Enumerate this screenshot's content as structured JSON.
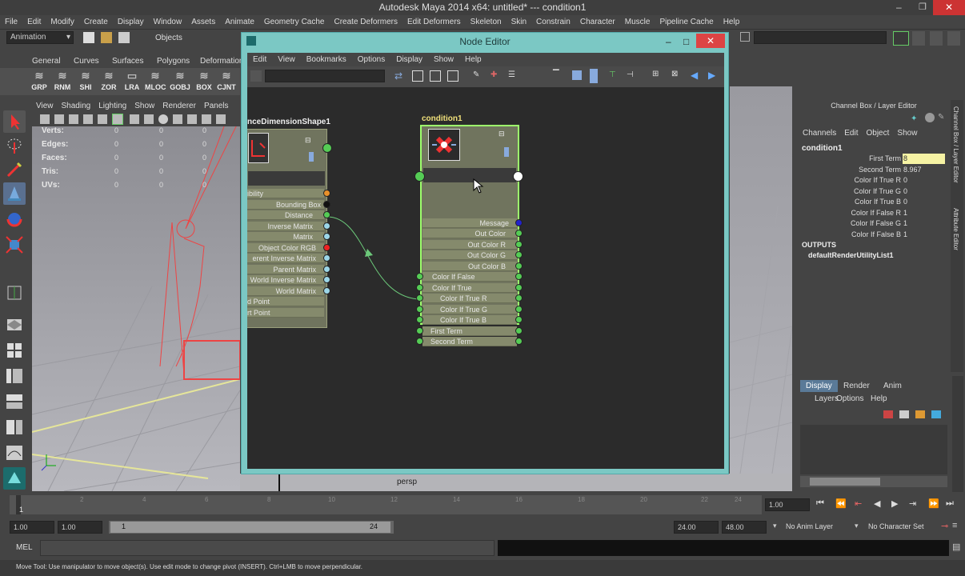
{
  "window": {
    "title": "Autodesk Maya 2014 x64: untitled*   ---   condition1"
  },
  "menubar": [
    "File",
    "Edit",
    "Modify",
    "Create",
    "Display",
    "Window",
    "Assets",
    "Animate",
    "Geometry Cache",
    "Create Deformers",
    "Edit Deformers",
    "Skeleton",
    "Skin",
    "Constrain",
    "Character",
    "Muscle",
    "Pipeline Cache",
    "Help"
  ],
  "statusline": {
    "menuset": "Animation",
    "selection_mode": "Objects"
  },
  "shelf": {
    "tabs": [
      "General",
      "Curves",
      "Surfaces",
      "Polygons",
      "Deformation"
    ],
    "icons": [
      "GRP",
      "RNM",
      "SHI",
      "ZOR",
      "LRA",
      "MLOC",
      "GOBJ",
      "BOX",
      "CJNT"
    ]
  },
  "viewport": {
    "menu": [
      "View",
      "Shading",
      "Lighting",
      "Show",
      "Renderer",
      "Panels"
    ],
    "hud": {
      "rows": [
        "Verts:",
        "Edges:",
        "Faces:",
        "Tris:",
        "UVs:"
      ],
      "zero": "0"
    },
    "camera": "persp"
  },
  "node_editor": {
    "title": "Node Editor",
    "menu": [
      "Edit",
      "View",
      "Bookmarks",
      "Options",
      "Display",
      "Show",
      "Help"
    ],
    "node_left": {
      "title": "nceDimensionShape1",
      "attrs": [
        "ibility",
        "Bounding Box",
        "Distance",
        "Inverse Matrix",
        "Matrix",
        "Object Color RGB",
        "erent Inverse Matrix",
        "Parent Matrix",
        "World Inverse Matrix",
        "World Matrix",
        "d Point",
        "rt Point"
      ]
    },
    "node_right": {
      "title": "condition1",
      "out_attrs": [
        "Message",
        "Out Color",
        "Out Color R",
        "Out Color G",
        "Out Color B"
      ],
      "in_attrs": [
        "Color If False",
        "Color If True",
        "Color If True R",
        "Color If True G",
        "Color If True B",
        "First Term",
        "Second Term"
      ]
    }
  },
  "channel_box": {
    "header": "Channel Box / Layer Editor",
    "menu": [
      "Channels",
      "Edit",
      "Object",
      "Show"
    ],
    "node": "condition1",
    "channels": [
      {
        "label": "First Term",
        "value": "8"
      },
      {
        "label": "Second Term",
        "value": "8.967"
      },
      {
        "label": "Color If True R",
        "value": "0"
      },
      {
        "label": "Color If True G",
        "value": "0"
      },
      {
        "label": "Color If True B",
        "value": "0"
      },
      {
        "label": "Color If False R",
        "value": "1"
      },
      {
        "label": "Color If False G",
        "value": "1"
      },
      {
        "label": "Color If False B",
        "value": "1"
      }
    ],
    "outputs_label": "OUTPUTS",
    "output_node": "defaultRenderUtilityList1",
    "side_tabs": [
      "Channel Box / Layer Editor",
      "Attribute Editor"
    ]
  },
  "layer_editor": {
    "tabs": [
      "Display",
      "Render",
      "Anim"
    ],
    "menu": [
      "Layers",
      "Options",
      "Help"
    ]
  },
  "timeline": {
    "ticks": [
      "1",
      "2",
      "4",
      "6",
      "8",
      "10",
      "12",
      "14",
      "16",
      "18",
      "20",
      "22",
      "24"
    ],
    "current_frame": "1.00"
  },
  "range": {
    "start": "1.00",
    "playback_start": "1.00",
    "range_start": "1",
    "range_end": "24",
    "playback_end": "24.00",
    "end": "48.00",
    "anim_layer": "No Anim Layer",
    "character": "No Character Set"
  },
  "mel": {
    "label": "MEL"
  },
  "help_line": "Move Tool: Use manipulator to move object(s). Use edit mode to change pivot (INSERT).  Ctrl+LMB to move perpendicular."
}
